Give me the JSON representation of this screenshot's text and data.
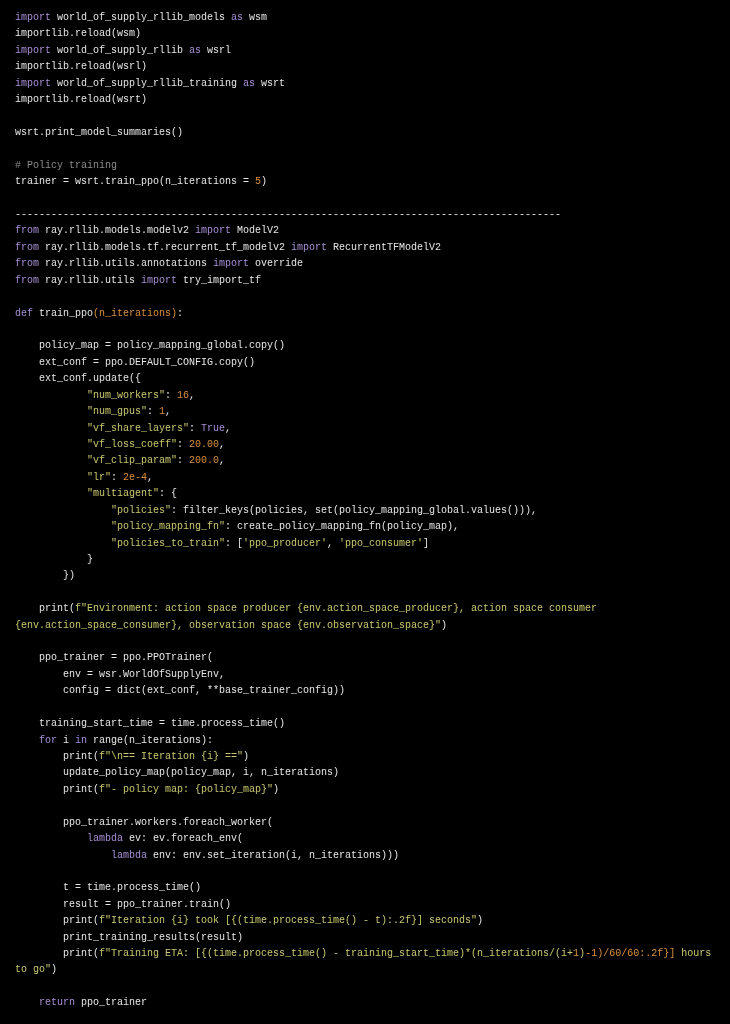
{
  "code_lines": [
    {
      "kind": "code",
      "tokens": [
        {
          "kind": "keyword",
          "text": "import"
        },
        {
          "kind": "plain",
          "text": " world_of_supply_rllib_models "
        },
        {
          "kind": "keyword",
          "text": "as"
        },
        {
          "kind": "plain",
          "text": " wsm"
        }
      ]
    },
    {
      "kind": "code",
      "tokens": [
        {
          "kind": "plain",
          "text": "importlib.reload(wsm)"
        }
      ]
    },
    {
      "kind": "code",
      "tokens": [
        {
          "kind": "keyword",
          "text": "import"
        },
        {
          "kind": "plain",
          "text": " world_of_supply_rllib "
        },
        {
          "kind": "keyword",
          "text": "as"
        },
        {
          "kind": "plain",
          "text": " wsrl"
        }
      ]
    },
    {
      "kind": "code",
      "tokens": [
        {
          "kind": "plain",
          "text": "importlib.reload(wsrl)"
        }
      ]
    },
    {
      "kind": "code",
      "tokens": [
        {
          "kind": "keyword",
          "text": "import"
        },
        {
          "kind": "plain",
          "text": " world_of_supply_rllib_training "
        },
        {
          "kind": "keyword",
          "text": "as"
        },
        {
          "kind": "plain",
          "text": " wsrt"
        }
      ]
    },
    {
      "kind": "code",
      "tokens": [
        {
          "kind": "plain",
          "text": "importlib.reload(wsrt)"
        }
      ]
    },
    {
      "kind": "blank"
    },
    {
      "kind": "code",
      "tokens": [
        {
          "kind": "plain",
          "text": "wsrt.print_model_summaries()"
        }
      ]
    },
    {
      "kind": "blank"
    },
    {
      "kind": "code",
      "tokens": [
        {
          "kind": "comment",
          "text": "# Policy training"
        }
      ]
    },
    {
      "kind": "code",
      "tokens": [
        {
          "kind": "plain",
          "text": "trainer = wsrt.train_ppo(n_iterations = "
        },
        {
          "kind": "number",
          "text": "5"
        },
        {
          "kind": "plain",
          "text": ")"
        }
      ]
    },
    {
      "kind": "blank"
    },
    {
      "kind": "code",
      "tokens": [
        {
          "kind": "plain",
          "text": "-------------------------------------------------------------------------------------------"
        }
      ]
    },
    {
      "kind": "code",
      "tokens": [
        {
          "kind": "keyword",
          "text": "from"
        },
        {
          "kind": "plain",
          "text": " ray.rllib.models.modelv2 "
        },
        {
          "kind": "keyword",
          "text": "import"
        },
        {
          "kind": "plain",
          "text": " ModelV2"
        }
      ]
    },
    {
      "kind": "code",
      "tokens": [
        {
          "kind": "keyword",
          "text": "from"
        },
        {
          "kind": "plain",
          "text": " ray.rllib.models.tf.recurrent_tf_modelv2 "
        },
        {
          "kind": "keyword",
          "text": "import"
        },
        {
          "kind": "plain",
          "text": " RecurrentTFModelV2"
        }
      ]
    },
    {
      "kind": "code",
      "tokens": [
        {
          "kind": "keyword",
          "text": "from"
        },
        {
          "kind": "plain",
          "text": " ray.rllib.utils.annotations "
        },
        {
          "kind": "keyword",
          "text": "import"
        },
        {
          "kind": "plain",
          "text": " override"
        }
      ]
    },
    {
      "kind": "code",
      "tokens": [
        {
          "kind": "keyword",
          "text": "from"
        },
        {
          "kind": "plain",
          "text": " ray.rllib.utils "
        },
        {
          "kind": "keyword",
          "text": "import"
        },
        {
          "kind": "plain",
          "text": " try_import_tf"
        }
      ]
    },
    {
      "kind": "blank"
    },
    {
      "kind": "code",
      "tokens": [
        {
          "kind": "keyword",
          "text": "def"
        },
        {
          "kind": "plain",
          "text": " train_ppo"
        },
        {
          "kind": "param",
          "text": "(n_iterations)"
        },
        {
          "kind": "plain",
          "text": ":"
        }
      ]
    },
    {
      "kind": "blank"
    },
    {
      "kind": "code",
      "tokens": [
        {
          "kind": "plain",
          "text": "    policy_map = policy_mapping_global.copy()"
        }
      ]
    },
    {
      "kind": "code",
      "tokens": [
        {
          "kind": "plain",
          "text": "    ext_conf = ppo.DEFAULT_CONFIG.copy()"
        }
      ]
    },
    {
      "kind": "code",
      "tokens": [
        {
          "kind": "plain",
          "text": "    ext_conf.update({"
        }
      ]
    },
    {
      "kind": "code",
      "tokens": [
        {
          "kind": "string",
          "text": "            \"num_workers\""
        },
        {
          "kind": "plain",
          "text": ": "
        },
        {
          "kind": "number",
          "text": "16"
        },
        {
          "kind": "plain",
          "text": ","
        }
      ]
    },
    {
      "kind": "code",
      "tokens": [
        {
          "kind": "string",
          "text": "            \"num_gpus\""
        },
        {
          "kind": "plain",
          "text": ": "
        },
        {
          "kind": "number",
          "text": "1"
        },
        {
          "kind": "plain",
          "text": ","
        }
      ]
    },
    {
      "kind": "code",
      "tokens": [
        {
          "kind": "string",
          "text": "            \"vf_share_layers\""
        },
        {
          "kind": "plain",
          "text": ": "
        },
        {
          "kind": "keyword",
          "text": "True"
        },
        {
          "kind": "plain",
          "text": ","
        }
      ]
    },
    {
      "kind": "code",
      "tokens": [
        {
          "kind": "string",
          "text": "            \"vf_loss_coeff\""
        },
        {
          "kind": "plain",
          "text": ": "
        },
        {
          "kind": "number",
          "text": "20.00"
        },
        {
          "kind": "plain",
          "text": ","
        }
      ]
    },
    {
      "kind": "code",
      "tokens": [
        {
          "kind": "string",
          "text": "            \"vf_clip_param\""
        },
        {
          "kind": "plain",
          "text": ": "
        },
        {
          "kind": "number",
          "text": "200.0"
        },
        {
          "kind": "plain",
          "text": ","
        }
      ]
    },
    {
      "kind": "code",
      "tokens": [
        {
          "kind": "string",
          "text": "            \"lr\""
        },
        {
          "kind": "plain",
          "text": ": "
        },
        {
          "kind": "number",
          "text": "2e-4"
        },
        {
          "kind": "plain",
          "text": ","
        }
      ]
    },
    {
      "kind": "code",
      "tokens": [
        {
          "kind": "string",
          "text": "            \"multiagent\""
        },
        {
          "kind": "plain",
          "text": ": {"
        }
      ]
    },
    {
      "kind": "code",
      "tokens": [
        {
          "kind": "string",
          "text": "                \"policies\""
        },
        {
          "kind": "plain",
          "text": ": filter_keys(policies, set(policy_mapping_global.values())),"
        }
      ]
    },
    {
      "kind": "code",
      "tokens": [
        {
          "kind": "string",
          "text": "                \"policy_mapping_fn\""
        },
        {
          "kind": "plain",
          "text": ": create_policy_mapping_fn(policy_map),"
        }
      ]
    },
    {
      "kind": "code",
      "tokens": [
        {
          "kind": "string",
          "text": "                \"policies_to_train\""
        },
        {
          "kind": "plain",
          "text": ": ["
        },
        {
          "kind": "string",
          "text": "'ppo_producer'"
        },
        {
          "kind": "plain",
          "text": ", "
        },
        {
          "kind": "string",
          "text": "'ppo_consumer'"
        },
        {
          "kind": "plain",
          "text": "]"
        }
      ]
    },
    {
      "kind": "code",
      "tokens": [
        {
          "kind": "plain",
          "text": "            }"
        }
      ]
    },
    {
      "kind": "code",
      "tokens": [
        {
          "kind": "plain",
          "text": "        })"
        }
      ]
    },
    {
      "kind": "blank"
    },
    {
      "kind": "code",
      "tokens": [
        {
          "kind": "plain",
          "text": "    print("
        },
        {
          "kind": "string",
          "text": "f\"Environment: action space producer {env.action_space_producer}, action space consumer"
        }
      ]
    },
    {
      "kind": "code",
      "tokens": [
        {
          "kind": "string",
          "text": "{env.action_space_consumer}, observation space {env.observation_space}\""
        },
        {
          "kind": "plain",
          "text": ")"
        }
      ]
    },
    {
      "kind": "blank"
    },
    {
      "kind": "code",
      "tokens": [
        {
          "kind": "plain",
          "text": "    ppo_trainer = ppo.PPOTrainer("
        }
      ]
    },
    {
      "kind": "code",
      "tokens": [
        {
          "kind": "plain",
          "text": "        env = wsr.WorldOfSupplyEnv,"
        }
      ]
    },
    {
      "kind": "code",
      "tokens": [
        {
          "kind": "plain",
          "text": "        config = dict(ext_conf, **base_trainer_config))"
        }
      ]
    },
    {
      "kind": "blank"
    },
    {
      "kind": "code",
      "tokens": [
        {
          "kind": "plain",
          "text": "    training_start_time = time.process_time()"
        }
      ]
    },
    {
      "kind": "code",
      "tokens": [
        {
          "kind": "keyword",
          "text": "    for"
        },
        {
          "kind": "plain",
          "text": " i "
        },
        {
          "kind": "keyword",
          "text": "in"
        },
        {
          "kind": "plain",
          "text": " range(n_iterations):"
        }
      ]
    },
    {
      "kind": "code",
      "tokens": [
        {
          "kind": "plain",
          "text": "        print("
        },
        {
          "kind": "string",
          "text": "f\"\\n== Iteration {i} ==\""
        },
        {
          "kind": "plain",
          "text": ")"
        }
      ]
    },
    {
      "kind": "code",
      "tokens": [
        {
          "kind": "plain",
          "text": "        update_policy_map(policy_map, i, n_iterations)"
        }
      ]
    },
    {
      "kind": "code",
      "tokens": [
        {
          "kind": "plain",
          "text": "        print("
        },
        {
          "kind": "string",
          "text": "f\"- policy map: {policy_map}\""
        },
        {
          "kind": "plain",
          "text": ")"
        }
      ]
    },
    {
      "kind": "blank"
    },
    {
      "kind": "code",
      "tokens": [
        {
          "kind": "plain",
          "text": "        ppo_trainer.workers.foreach_worker("
        }
      ]
    },
    {
      "kind": "code",
      "tokens": [
        {
          "kind": "keyword",
          "text": "            lambda"
        },
        {
          "kind": "plain",
          "text": " ev: ev.foreach_env("
        }
      ]
    },
    {
      "kind": "code",
      "tokens": [
        {
          "kind": "keyword",
          "text": "                lambda"
        },
        {
          "kind": "plain",
          "text": " env: env.set_iteration(i, n_iterations)))"
        }
      ]
    },
    {
      "kind": "blank"
    },
    {
      "kind": "code",
      "tokens": [
        {
          "kind": "plain",
          "text": "        t = time.process_time()"
        }
      ]
    },
    {
      "kind": "code",
      "tokens": [
        {
          "kind": "plain",
          "text": "        result = ppo_trainer.train()"
        }
      ]
    },
    {
      "kind": "code",
      "tokens": [
        {
          "kind": "plain",
          "text": "        print("
        },
        {
          "kind": "string",
          "text": "f\"Iteration {i} took [{(time.process_time() - t):.2f}] seconds\""
        },
        {
          "kind": "plain",
          "text": ")"
        }
      ]
    },
    {
      "kind": "code",
      "tokens": [
        {
          "kind": "plain",
          "text": "        print_training_results(result)"
        }
      ]
    },
    {
      "kind": "code",
      "tokens": [
        {
          "kind": "plain",
          "text": "        print("
        },
        {
          "kind": "string",
          "text": "f\"Training ETA: [{(time.process_time() - training_start_time)*(n_iterations/(i+"
        },
        {
          "kind": "number",
          "text": "1"
        },
        {
          "kind": "string",
          "text": ")"
        },
        {
          "kind": "number",
          "text": "-1)/60/60:.2f}]"
        },
        {
          "kind": "string",
          "text": " hours"
        }
      ]
    },
    {
      "kind": "code",
      "tokens": [
        {
          "kind": "string",
          "text": "to go\""
        },
        {
          "kind": "plain",
          "text": ")"
        }
      ]
    },
    {
      "kind": "blank"
    },
    {
      "kind": "code",
      "tokens": [
        {
          "kind": "keyword",
          "text": "    return"
        },
        {
          "kind": "plain",
          "text": " ppo_trainer"
        }
      ]
    }
  ]
}
